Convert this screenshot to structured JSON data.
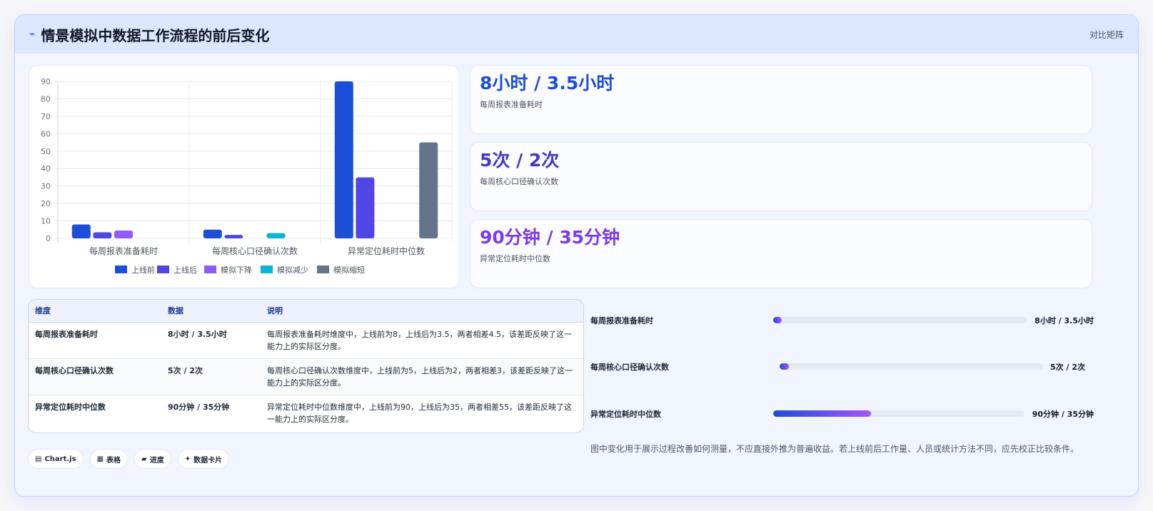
{
  "header": {
    "icon": "chart-line-icon",
    "title": "情景模拟中数据工作流程的前后变化",
    "right_label": "对比矩阵"
  },
  "chart_data": {
    "type": "bar",
    "categories": [
      "每周报表准备耗时",
      "每周核心口径确认次数",
      "异常定位耗时中位数"
    ],
    "series": [
      {
        "name": "上线前",
        "color": "#1d4ed8",
        "values": [
          8,
          5,
          90
        ]
      },
      {
        "name": "上线后",
        "color": "#4f46e5",
        "values": [
          3.5,
          2,
          35
        ]
      },
      {
        "name": "模拟下降",
        "color": "#8b5cf6",
        "values": [
          4.5,
          null,
          null
        ]
      },
      {
        "name": "模拟减少",
        "color": "#06b6d4",
        "values": [
          null,
          3,
          null
        ]
      },
      {
        "name": "模拟缩短",
        "color": "#64748b",
        "values": [
          null,
          null,
          55
        ]
      }
    ],
    "yticks": [
      0,
      10,
      20,
      30,
      40,
      50,
      60,
      70,
      80,
      90
    ],
    "ylim": [
      0,
      90
    ],
    "legend_position": "bottom",
    "grid": true
  },
  "stats": [
    {
      "value": "8小时 / 3.5小时",
      "label": "每周报表准备耗时",
      "color": "#1d4ed8"
    },
    {
      "value": "5次 / 2次",
      "label": "每周核心口径确认次数",
      "color": "#4338ca"
    },
    {
      "value": "90分钟 / 35分钟",
      "label": "异常定位耗时中位数",
      "color": "#7c3aed"
    }
  ],
  "table": {
    "headers": [
      "维度",
      "数据",
      "说明"
    ],
    "rows": [
      {
        "dim": "每周报表准备耗时",
        "data": "8小时 / 3.5小时",
        "desc": "每周报表准备耗时维度中，上线前为8，上线后为3.5，两者相差4.5，该差距反映了这一能力上的实际区分度。"
      },
      {
        "dim": "每周核心口径确认次数",
        "data": "5次 / 2次",
        "desc": "每周核心口径确认次数维度中，上线前为5，上线后为2，两者相差3，该差距反映了这一能力上的实际区分度。"
      },
      {
        "dim": "异常定位耗时中位数",
        "data": "90分钟 / 35分钟",
        "desc": "异常定位耗时中位数维度中，上线前为90，上线后为35，两者相差55，该差距反映了这一能力上的实际区分度。"
      }
    ]
  },
  "pills": [
    {
      "icon": "chart-icon",
      "glyph": "▤",
      "label": "Chart.js"
    },
    {
      "icon": "table-icon",
      "glyph": "▦",
      "label": "表格"
    },
    {
      "icon": "progress-icon",
      "glyph": "▰",
      "label": "进度"
    },
    {
      "icon": "card-icon",
      "glyph": "✦",
      "label": "数据卡片"
    }
  ],
  "progress": [
    {
      "label": "每周报表准备耗时",
      "value": "8小时 / 3.5小时",
      "fraction": 0.035
    },
    {
      "label": "每周核心口径确认次数",
      "value": "5次 / 2次",
      "fraction": 0.02
    },
    {
      "label": "异常定位耗时中位数",
      "value": "90分钟 / 35分钟",
      "fraction": 0.39
    }
  ],
  "note": "图中变化用于展示过程改善如何测量，不应直接外推为普遍收益。若上线前后工作量、人员或统计方法不同，应先校正比较条件。"
}
